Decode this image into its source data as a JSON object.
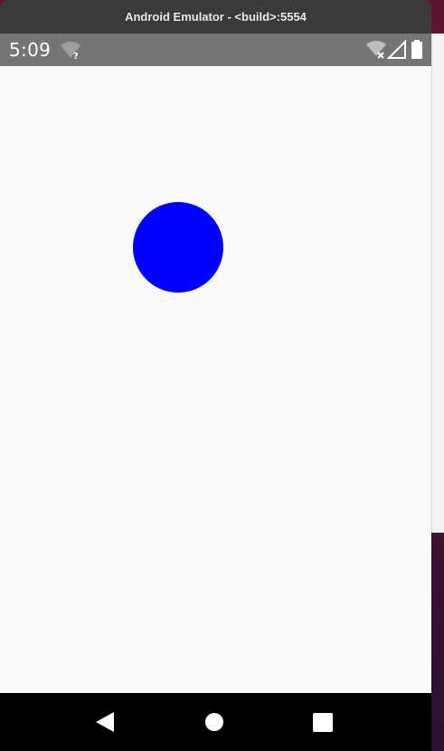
{
  "window": {
    "title": "Android Emulator - <build>:5554"
  },
  "status_bar": {
    "time": "5:09",
    "icons": [
      "wifi-unknown-icon",
      "wifi-off-icon",
      "cellular-signal-icon",
      "battery-icon"
    ]
  },
  "content": {
    "circle_color": "#0000ff",
    "background_color": "#fafafa"
  },
  "nav_bar": {
    "buttons": [
      "back-icon",
      "home-icon",
      "recents-icon"
    ]
  },
  "colors": {
    "status_bar": "#757575",
    "nav_bar": "#000000",
    "title_bar": "#3b3a38"
  }
}
